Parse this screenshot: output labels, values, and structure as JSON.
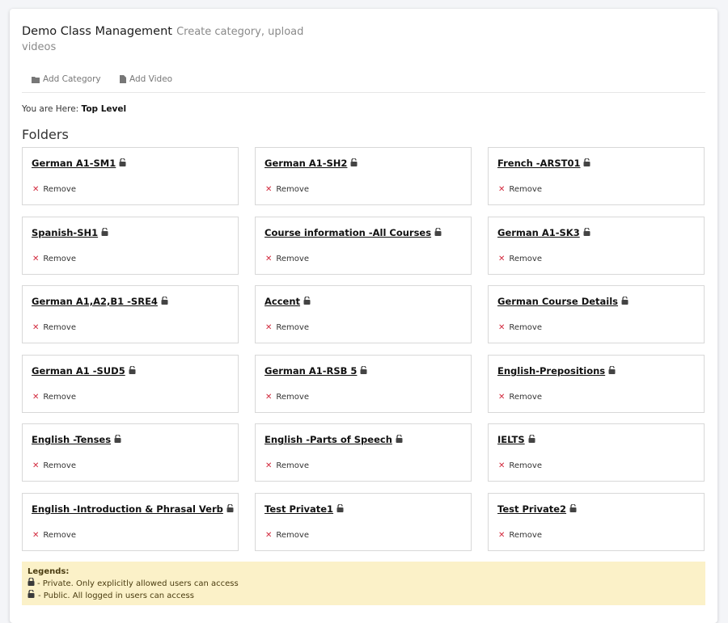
{
  "header": {
    "title": "Demo Class Management",
    "subtitle": "Create category, upload videos"
  },
  "tabs": [
    {
      "label": "Add Category",
      "icon": "folder-icon"
    },
    {
      "label": "Add Video",
      "icon": "file-icon"
    }
  ],
  "breadcrumb": {
    "prefix": "You are Here:",
    "current": "Top Level"
  },
  "folders_title": "Folders",
  "remove_label": "Remove",
  "folders": [
    "German A1-SM1",
    "German A1-SH2",
    "French -ARST01",
    "Spanish-SH1",
    "Course information -All Courses",
    "German A1-SK3",
    "German A1,A2,B1 -SRE4",
    "Accent",
    "German Course Details",
    "German A1 -SUD5",
    "German A1-RSB 5",
    "English-Prepositions",
    "English -Tenses",
    "English -Parts of Speech",
    "IELTS",
    "English -Introduction & Phrasal Verb",
    "Test Private1",
    "Test Private2"
  ],
  "legend": {
    "title": "Legends:",
    "private": "- Private. Only explicitly allowed users can access",
    "public": "- Public. All logged in users can access"
  },
  "colors": {
    "remove_x": "#d2283c",
    "legend_bg": "#fbf1c8"
  }
}
